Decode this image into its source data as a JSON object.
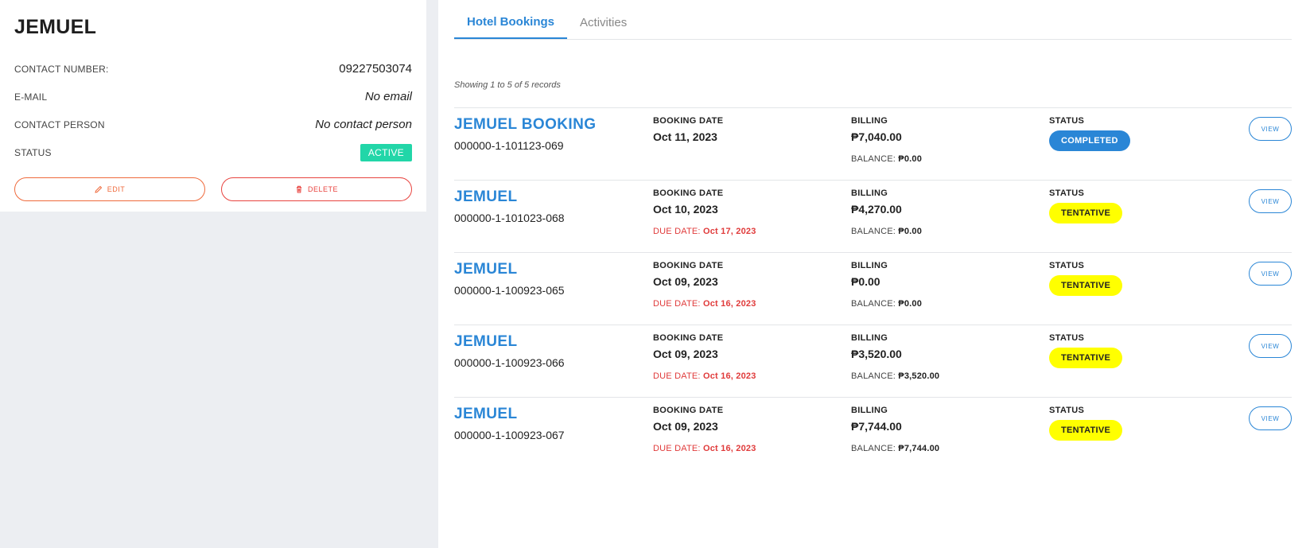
{
  "guest": {
    "name": "JEMUEL",
    "fields": [
      {
        "label": "CONTACT NUMBER:",
        "value": "09227503074"
      },
      {
        "label": "E-MAIL",
        "value": "No email"
      },
      {
        "label": "CONTACT PERSON",
        "value": "No contact person"
      },
      {
        "label": "STATUS",
        "value": "ACTIVE"
      }
    ],
    "edit_label": "EDIT",
    "delete_label": "DELETE",
    "colors": {
      "active_badge": "#22d6a8",
      "edit": "#ef6a3c",
      "delete": "#e8433f"
    }
  },
  "tabs": [
    {
      "label": "Hotel Bookings",
      "active": true
    },
    {
      "label": "Activities",
      "active": false
    }
  ],
  "records_info": "Showing 1 to 5 of 5 records",
  "labels": {
    "booking_date": "BOOKING DATE",
    "billing": "BILLING",
    "status": "STATUS",
    "due_date": "DUE DATE:",
    "balance": "BALANCE:",
    "view": "VIEW"
  },
  "bookings": [
    {
      "name": "JEMUEL BOOKING",
      "code": "000000-1-101123-069",
      "booking_date": "Oct 11, 2023",
      "due_date": "",
      "billing": "₱7,040.00",
      "balance": "₱0.00",
      "status": "COMPLETED",
      "status_color": "#2a86d6"
    },
    {
      "name": "JEMUEL",
      "code": "000000-1-101023-068",
      "booking_date": "Oct 10, 2023",
      "due_date": "Oct 17, 2023",
      "billing": "₱4,270.00",
      "balance": "₱0.00",
      "status": "TENTATIVE",
      "status_color": "#ffff00"
    },
    {
      "name": "JEMUEL",
      "code": "000000-1-100923-065",
      "booking_date": "Oct 09, 2023",
      "due_date": "Oct 16, 2023",
      "billing": "₱0.00",
      "balance": "₱0.00",
      "status": "TENTATIVE",
      "status_color": "#ffff00"
    },
    {
      "name": "JEMUEL",
      "code": "000000-1-100923-066",
      "booking_date": "Oct 09, 2023",
      "due_date": "Oct 16, 2023",
      "billing": "₱3,520.00",
      "balance": "₱3,520.00",
      "status": "TENTATIVE",
      "status_color": "#ffff00"
    },
    {
      "name": "JEMUEL",
      "code": "000000-1-100923-067",
      "booking_date": "Oct 09, 2023",
      "due_date": "Oct 16, 2023",
      "billing": "₱7,744.00",
      "balance": "₱7,744.00",
      "status": "TENTATIVE",
      "status_color": "#ffff00"
    }
  ]
}
